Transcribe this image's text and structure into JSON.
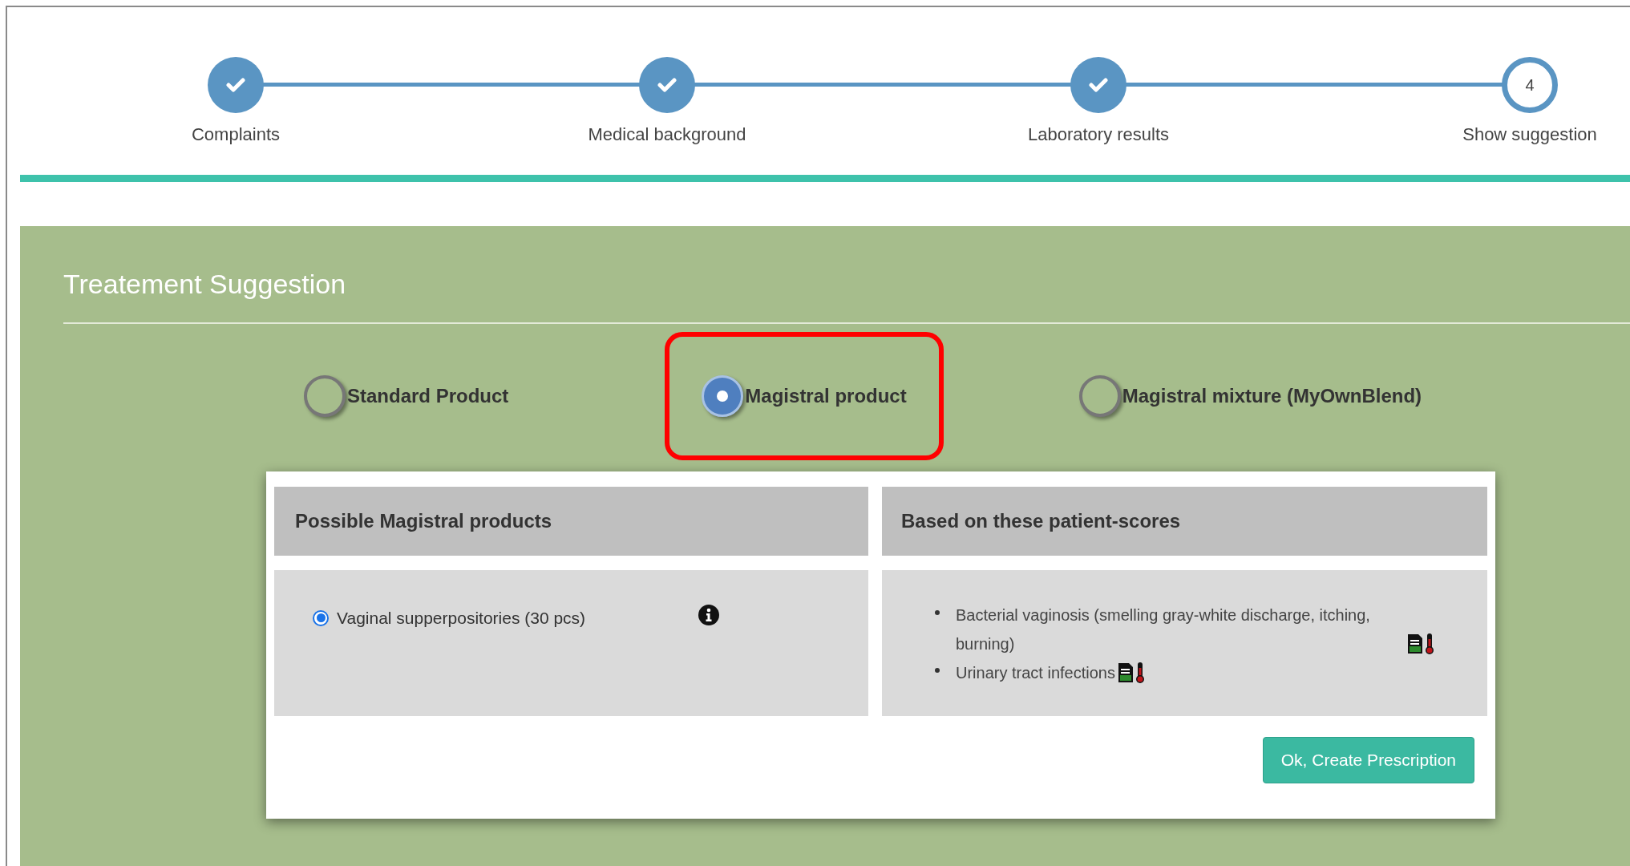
{
  "steps": [
    {
      "label": "Complaints",
      "done": true
    },
    {
      "label": "Medical background",
      "done": true
    },
    {
      "label": "Laboratory results",
      "done": true
    },
    {
      "label": "Show suggestion",
      "done": false,
      "number": "4"
    }
  ],
  "section": {
    "title": "Treatement Suggestion"
  },
  "product_types": [
    {
      "label": "Standard Product",
      "selected": false,
      "highlighted": false
    },
    {
      "label": "Magistral product",
      "selected": true,
      "highlighted": true
    },
    {
      "label": "Magistral mixture (MyOwnBlend)",
      "selected": false,
      "highlighted": false
    }
  ],
  "card": {
    "columns": [
      "Possible Magistral products",
      "Based on these patient-scores"
    ],
    "products": [
      {
        "label": "Vaginal supperpositories (30 pcs)",
        "selected": true
      }
    ],
    "scores": [
      {
        "text": "Bacterial vaginosis (smelling gray-white discharge, itching, burning)"
      },
      {
        "text": "Urinary tract infections"
      }
    ],
    "button": "Ok, Create Prescription"
  }
}
